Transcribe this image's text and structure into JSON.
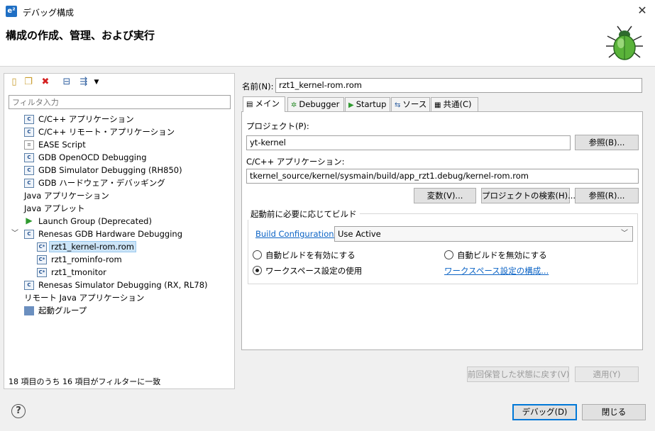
{
  "window": {
    "title": "デバッグ構成",
    "app_icon": "e²",
    "close_glyph": "✕"
  },
  "header": {
    "title": "構成の作成、管理、および実行"
  },
  "left": {
    "filter_placeholder": "フィルタ入力",
    "toolbar_icons": [
      "new-config-icon",
      "duplicate-icon",
      "delete-icon",
      "collapse-all-icon",
      "filter-icon",
      "dropdown-icon"
    ],
    "tree": [
      {
        "label": "C/C++ アプリケーション",
        "icon": "c",
        "level": 0
      },
      {
        "label": "C/C++ リモート・アプリケーション",
        "icon": "c",
        "level": 0
      },
      {
        "label": "EASE Script",
        "icon": "page",
        "level": 0
      },
      {
        "label": "GDB OpenOCD Debugging",
        "icon": "c",
        "level": 0
      },
      {
        "label": "GDB Simulator Debugging (RH850)",
        "icon": "c",
        "level": 0
      },
      {
        "label": "GDB ハードウェア・デバッギング",
        "icon": "c",
        "level": 0
      },
      {
        "label": "Java アプリケーション",
        "icon": "none",
        "level": 0
      },
      {
        "label": "Java アプレット",
        "icon": "none",
        "level": 0
      },
      {
        "label": "Launch Group (Deprecated)",
        "icon": "play",
        "level": 0
      },
      {
        "label": "Renesas GDB Hardware Debugging",
        "icon": "c",
        "level": 0,
        "expanded": true
      },
      {
        "label": "rzt1_kernel-rom.rom",
        "icon": "c",
        "level": 1,
        "selected": true
      },
      {
        "label": "rzt1_rominfo-rom",
        "icon": "c",
        "level": 1
      },
      {
        "label": "rzt1_tmonitor",
        "icon": "c",
        "level": 1
      },
      {
        "label": "Renesas Simulator Debugging (RX, RL78)",
        "icon": "c",
        "level": 0
      },
      {
        "label": "リモート Java アプリケーション",
        "icon": "none",
        "level": 0
      },
      {
        "label": "起動グループ",
        "icon": "group",
        "level": 0
      }
    ],
    "status": "18 項目のうち 16 項目がフィルターに一致"
  },
  "right": {
    "name_label": "名前(N):",
    "name_value": "rzt1_kernel-rom.rom",
    "tabs": [
      {
        "label": "メイン",
        "icon": "main-tab-icon",
        "active": true
      },
      {
        "label": "Debugger",
        "icon": "debugger-tab-icon"
      },
      {
        "label": "Startup",
        "icon": "startup-tab-icon"
      },
      {
        "label": "ソース",
        "icon": "source-tab-icon"
      },
      {
        "label": "共通(C)",
        "icon": "common-tab-icon"
      }
    ],
    "project_label": "プロジェクト(P):",
    "project_value": "yt-kernel",
    "browse1": "参照(B)...",
    "app_label": "C/C++ アプリケーション:",
    "app_value": "tkernel_source/kernel/sysmain/build/app_rzt1.debug/kernel-rom.rom",
    "variables_button": "変数(V)...",
    "search_project_button": "プロジェクトの検索(H)...",
    "browse2": "参照(R)...",
    "build_group_label": "起動前に必要に応じてビルド",
    "build_config_link": "Build Configuration:",
    "build_config_value": "Use Active",
    "radio_enable": "自動ビルドを有効にする",
    "radio_disable": "自動ビルドを無効にする",
    "radio_workspace": "ワークスペース設定の使用",
    "workspace_link": "ワークスペース設定の構成...",
    "revert_button": "前回保管した状態に戻す(V)",
    "apply_button": "適用(Y)"
  },
  "footer": {
    "debug_button": "デバッグ(D)",
    "close_button": "閉じる",
    "help_glyph": "?"
  }
}
